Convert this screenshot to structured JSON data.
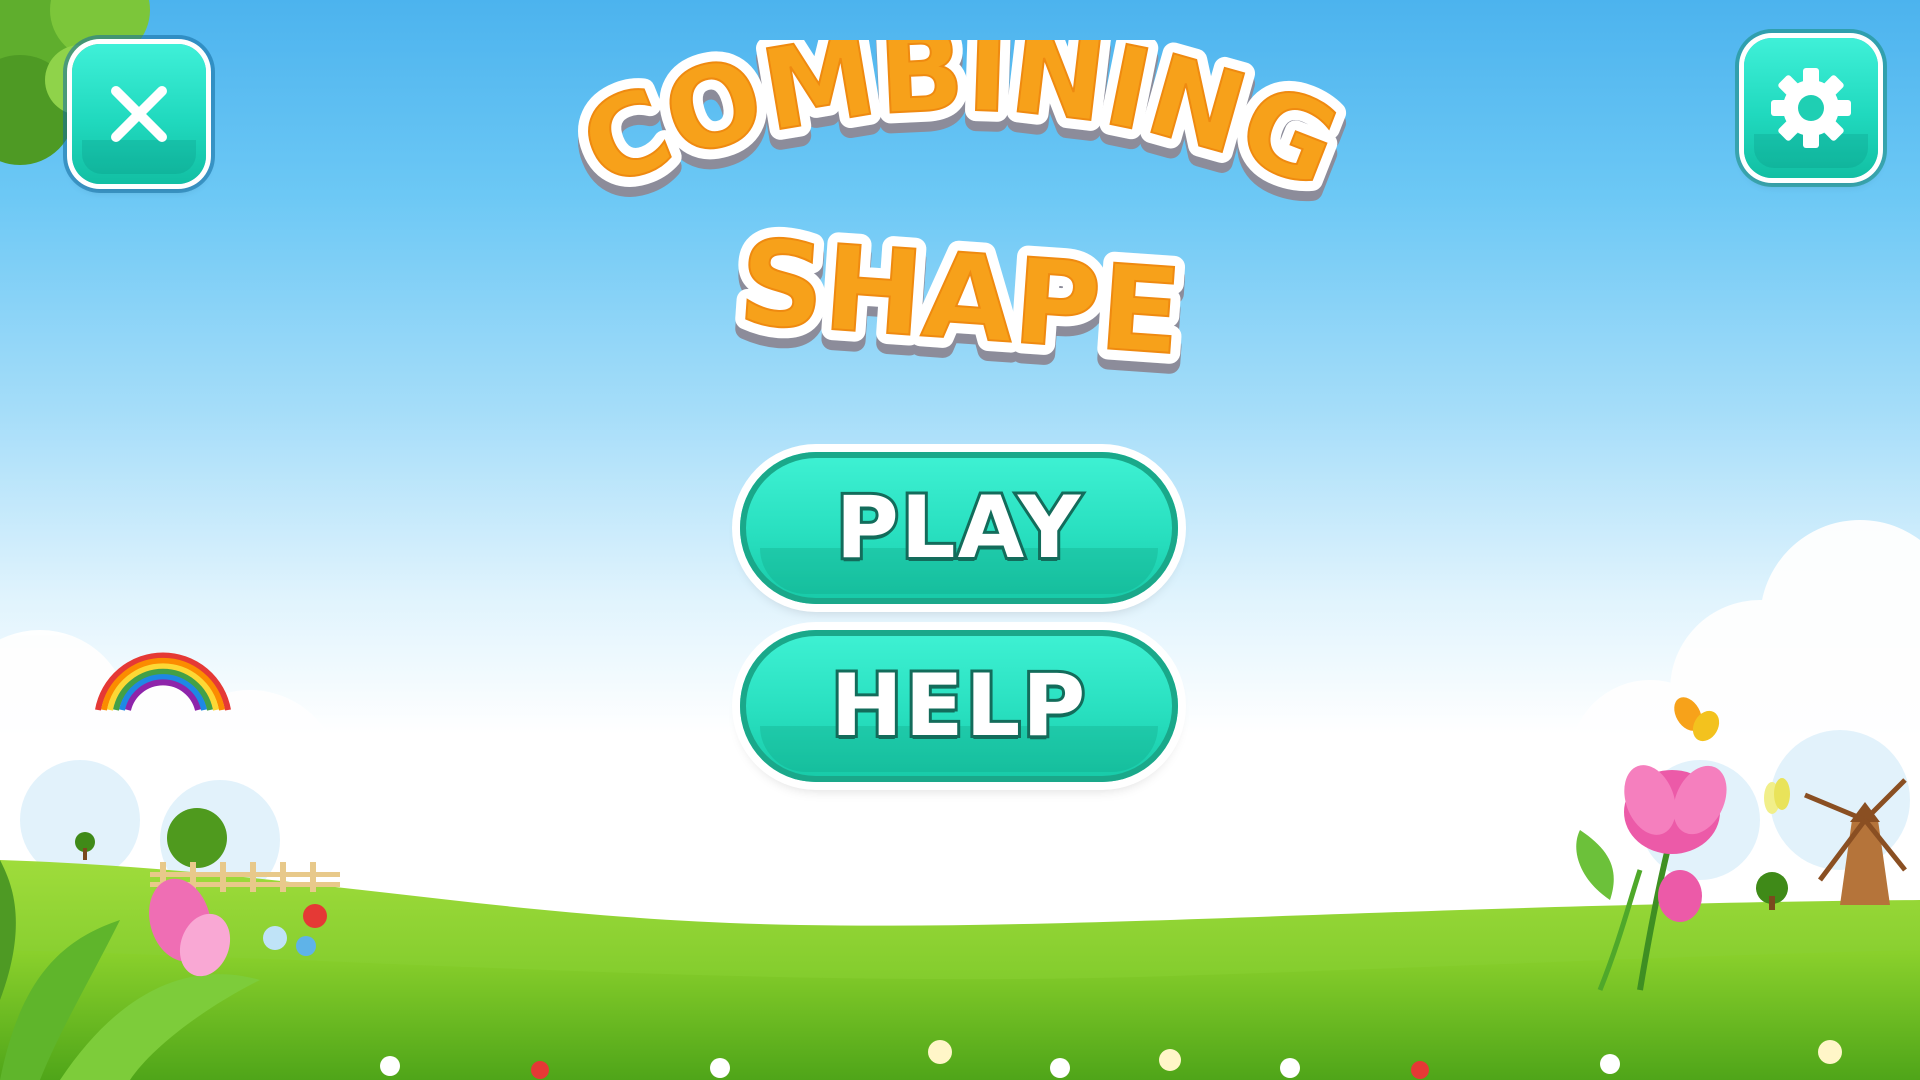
{
  "title": {
    "line1": "COMBINING",
    "line2": "SHAPE"
  },
  "menu": {
    "play_label": "PLAY",
    "help_label": "HELP"
  },
  "icons": {
    "close": "close-icon",
    "settings": "gear-icon"
  },
  "colors": {
    "title_fill": "#f7a11a",
    "title_outline": "#ffffff",
    "button_teal": "#28dfbf",
    "button_outline": "#136c5b",
    "sky_top": "#4cb3ee",
    "grass": "#7ccb2a"
  }
}
